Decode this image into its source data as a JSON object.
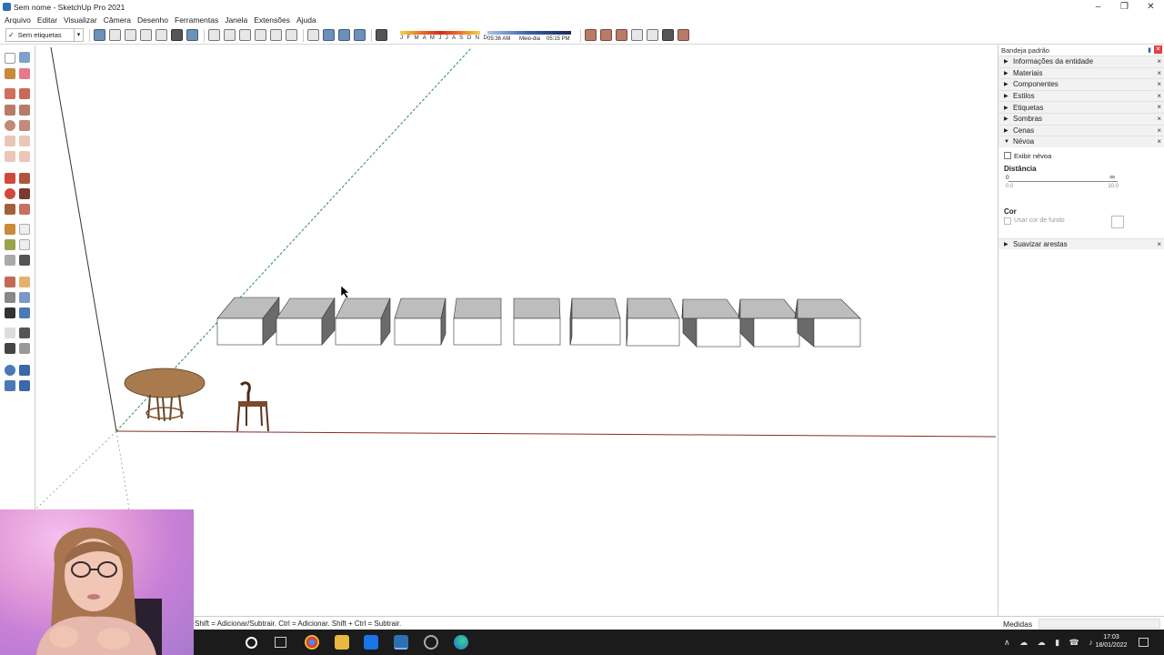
{
  "window": {
    "title": "Sem nome - SketchUp Pro 2021"
  },
  "menu": [
    "Arquivo",
    "Editar",
    "Visualizar",
    "Câmera",
    "Desenho",
    "Ferramentas",
    "Janela",
    "Extensões",
    "Ajuda"
  ],
  "toolbar": {
    "tag_selector": "Sem etiquetas",
    "shadow_months": "J F M A M J J A S O N D",
    "time_start": "05:36 AM",
    "time_mid": "Meio-dia",
    "time_end": "05:15 PM"
  },
  "tray": {
    "title": "Bandeja padrão",
    "panels": [
      "Informações da entidade",
      "Materiais",
      "Componentes",
      "Estilos",
      "Etiquetas",
      "Sombras",
      "Cenas"
    ],
    "open_panel": "Névoa",
    "fog": {
      "show_fog_label": "Exibir névoa",
      "show_fog_checked": false,
      "distance_label": "Distância",
      "slider_min": "0",
      "slider_max": "∞",
      "slider_min_sub": "0.0",
      "slider_max_sub": "10.0",
      "color_label": "Cor",
      "use_bg_label": "Usar cor de fundo"
    },
    "bottom_panel": "Suavizar arestas"
  },
  "status": {
    "message": "Shift = Adicionar/Subtrair. Ctrl = Adicionar. Shift + Ctrl = Subtrair.",
    "measure_label": "Medidas"
  },
  "taskbar": {
    "time": "17:03",
    "date": "18/01/2022"
  }
}
